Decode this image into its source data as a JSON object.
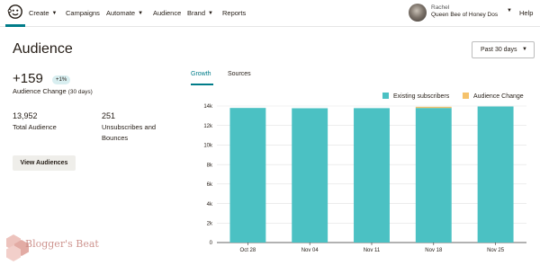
{
  "nav": {
    "items": [
      {
        "label": "Create",
        "has_dropdown": true
      },
      {
        "label": "Campaigns",
        "has_dropdown": false
      },
      {
        "label": "Automate",
        "has_dropdown": true
      },
      {
        "label": "Audience",
        "has_dropdown": false
      },
      {
        "label": "Brand",
        "has_dropdown": true
      },
      {
        "label": "Reports",
        "has_dropdown": false
      }
    ],
    "user_name": "Rachel",
    "user_org": "Queen Bee of Honey Dos",
    "help_label": "Help",
    "accent_color": "#007c89"
  },
  "page": {
    "title": "Audience",
    "date_range": "Past 30 days"
  },
  "stats": {
    "audience_change": "+159",
    "change_percent": "+1%",
    "change_label": "Audience Change",
    "change_period": "(30 days)",
    "total_audience": "13,952",
    "total_audience_label": "Total Audience",
    "unsubscribes": "251",
    "unsubscribes_label": "Unsubscribes and Bounces",
    "view_button": "View Audiences"
  },
  "tabs": [
    {
      "label": "Growth",
      "active": true
    },
    {
      "label": "Sources",
      "active": false
    }
  ],
  "chart_data": {
    "type": "bar",
    "stacked": true,
    "categories": [
      "Oct 28",
      "Nov 04",
      "Nov 11",
      "Nov 18",
      "Nov 25"
    ],
    "series": [
      {
        "name": "Existing subscribers",
        "color": "#4bc1c3",
        "values": [
          13800,
          13770,
          13780,
          13800,
          13950
        ]
      },
      {
        "name": "Audience Change",
        "color": "#f5c26b",
        "values": [
          0,
          0,
          0,
          120,
          0
        ]
      }
    ],
    "y_ticks": [
      "0",
      "2k",
      "4k",
      "6k",
      "8k",
      "10k",
      "12k",
      "14k"
    ],
    "ylim": [
      0,
      14000
    ],
    "grid": true,
    "legend_position": "top-right"
  },
  "watermark": {
    "text": "Blogger's Beat"
  }
}
